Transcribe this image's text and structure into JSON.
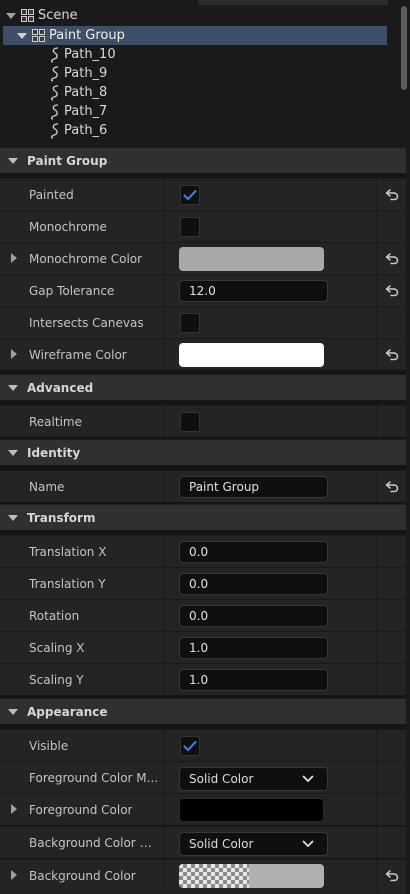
{
  "tree": {
    "root": "Scene",
    "selected": "Paint Group",
    "children": [
      "Path_10",
      "Path_9",
      "Path_8",
      "Path_7",
      "Path_6"
    ]
  },
  "sections": {
    "paint_group": {
      "title": "Paint Group",
      "painted": {
        "label": "Painted",
        "checked": true
      },
      "monochrome": {
        "label": "Monochrome",
        "checked": false
      },
      "monochrome_color": {
        "label": "Monochrome Color",
        "color": "#a9a9a9"
      },
      "gap_tolerance": {
        "label": "Gap Tolerance",
        "value": "12.0"
      },
      "intersects_canvas": {
        "label": "Intersects Canevas",
        "checked": false
      },
      "wireframe_color": {
        "label": "Wireframe Color",
        "color": "#ffffff"
      }
    },
    "advanced": {
      "title": "Advanced",
      "realtime": {
        "label": "Realtime",
        "checked": false
      }
    },
    "identity": {
      "title": "Identity",
      "name": {
        "label": "Name",
        "value": "Paint Group"
      }
    },
    "transform": {
      "title": "Transform",
      "translation_x": {
        "label": "Translation X",
        "value": "0.0"
      },
      "translation_y": {
        "label": "Translation Y",
        "value": "0.0"
      },
      "rotation": {
        "label": "Rotation",
        "value": "0.0"
      },
      "scaling_x": {
        "label": "Scaling X",
        "value": "1.0"
      },
      "scaling_y": {
        "label": "Scaling Y",
        "value": "1.0"
      }
    },
    "appearance": {
      "title": "Appearance",
      "visible": {
        "label": "Visible",
        "checked": true
      },
      "foreground_color_mode": {
        "label": "Foreground Color M...",
        "value": "Solid Color"
      },
      "foreground_color": {
        "label": "Foreground Color",
        "color": "#000000"
      },
      "background_color_mode": {
        "label": "Background Color M...",
        "value": "Solid Color"
      },
      "background_color": {
        "label": "Background Color",
        "color": "#b0b0b0",
        "transparent_preview": true
      }
    }
  },
  "colors": {
    "accent": "#3d7bd9",
    "selection": "#3d4e66",
    "panel": "#242424",
    "section_header": "#303030"
  },
  "icons": {
    "reset": "reset-arrow-icon",
    "scene": "scene-icon",
    "path": "path-icon",
    "check": "checkmark-icon",
    "dropdown": "chevron-down-icon"
  }
}
